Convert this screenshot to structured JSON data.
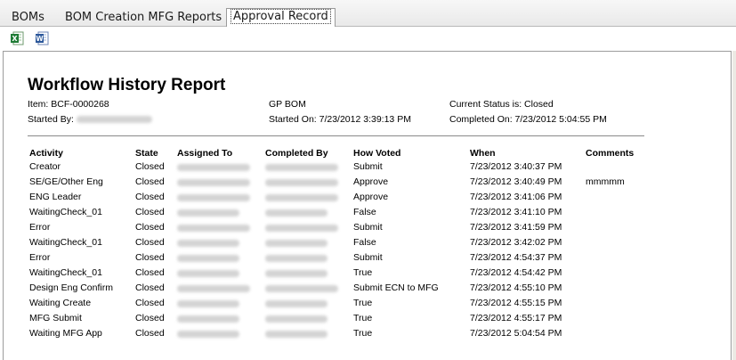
{
  "tabs": [
    {
      "label": "BOMs"
    },
    {
      "label": "BOM Creation MFG Reports"
    },
    {
      "label": "Approval Record"
    }
  ],
  "toolbar": {
    "export_excel_icon": "excel-icon",
    "export_word_icon": "word-icon",
    "excel_glyph": "X",
    "word_glyph": "W"
  },
  "report": {
    "title": "Workflow History Report",
    "item": "Item: BCF-0000268",
    "bom_type": "GP BOM",
    "current_status": "Current Status is: Closed",
    "started_by_label": "Started By:",
    "started_on": "Started On: 7/23/2012 3:39:13 PM",
    "completed_on": "Completed On: 7/23/2012 5:04:55 PM"
  },
  "table": {
    "headers": [
      "Activity",
      "State",
      "Assigned To",
      "Completed By",
      "How Voted",
      "When",
      "Comments"
    ],
    "rows": [
      {
        "activity": "Creator",
        "state": "Closed",
        "voted": "Submit",
        "when": "7/23/2012 3:40:37 PM",
        "comment": ""
      },
      {
        "activity": "SE/GE/Other Eng",
        "state": "Closed",
        "voted": "Approve",
        "when": "7/23/2012 3:40:49 PM",
        "comment": "mmmmm"
      },
      {
        "activity": "ENG Leader",
        "state": "Closed",
        "voted": "Approve",
        "when": "7/23/2012 3:41:06 PM",
        "comment": ""
      },
      {
        "activity": "WaitingCheck_01",
        "state": "Closed",
        "voted": "False",
        "when": "7/23/2012 3:41:10 PM",
        "comment": ""
      },
      {
        "activity": "Error",
        "state": "Closed",
        "voted": "Submit",
        "when": "7/23/2012 3:41:59 PM",
        "comment": ""
      },
      {
        "activity": "WaitingCheck_01",
        "state": "Closed",
        "voted": "False",
        "when": "7/23/2012 3:42:02 PM",
        "comment": ""
      },
      {
        "activity": "Error",
        "state": "Closed",
        "voted": "Submit",
        "when": "7/23/2012 4:54:37 PM",
        "comment": ""
      },
      {
        "activity": "WaitingCheck_01",
        "state": "Closed",
        "voted": "True",
        "when": "7/23/2012 4:54:42 PM",
        "comment": ""
      },
      {
        "activity": "Design Eng Confirm",
        "state": "Closed",
        "voted": "Submit ECN to MFG",
        "when": "7/23/2012 4:55:10 PM",
        "comment": ""
      },
      {
        "activity": "Waiting Create",
        "state": "Closed",
        "voted": "True",
        "when": "7/23/2012 4:55:15 PM",
        "comment": ""
      },
      {
        "activity": "MFG Submit",
        "state": "Closed",
        "voted": "True",
        "when": "7/23/2012 4:55:17 PM",
        "comment": ""
      },
      {
        "activity": "Waiting MFG App",
        "state": "Closed",
        "voted": "True",
        "when": "7/23/2012 5:04:54 PM",
        "comment": ""
      }
    ]
  },
  "colors": {
    "excel_green": "#1e7b34",
    "word_blue": "#2b579a",
    "redacted_gray": "#c9c9c9"
  }
}
